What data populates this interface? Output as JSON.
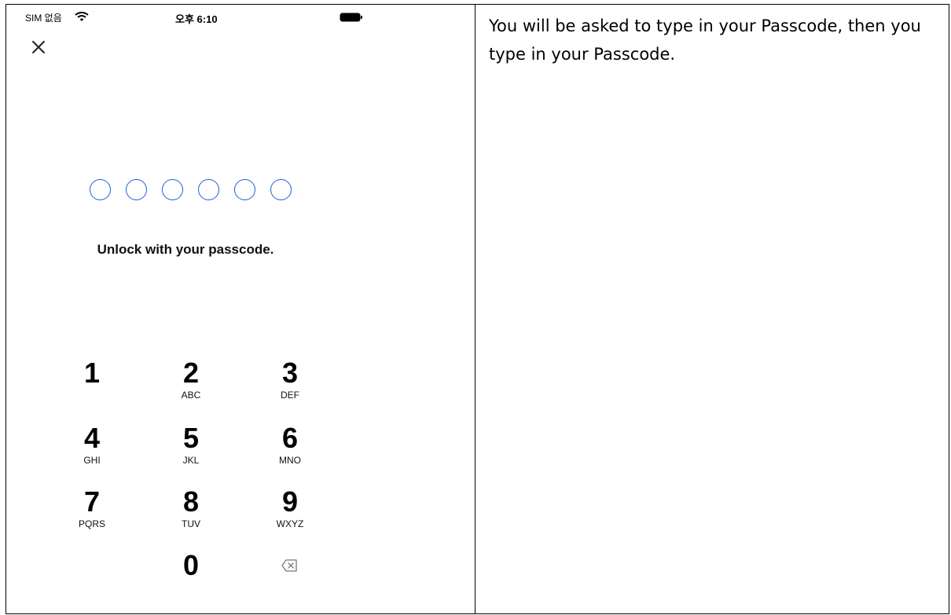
{
  "status_bar": {
    "carrier": "SIM 없음",
    "time": "오후 6:10"
  },
  "passcode": {
    "dot_count": 6,
    "dot_color": "#1f5fd6",
    "prompt": "Unlock with your passcode."
  },
  "keypad": {
    "keys": [
      {
        "digit": "1",
        "letters": ""
      },
      {
        "digit": "2",
        "letters": "ABC"
      },
      {
        "digit": "3",
        "letters": "DEF"
      },
      {
        "digit": "4",
        "letters": "GHI"
      },
      {
        "digit": "5",
        "letters": "JKL"
      },
      {
        "digit": "6",
        "letters": "MNO"
      },
      {
        "digit": "7",
        "letters": "PQRS"
      },
      {
        "digit": "8",
        "letters": "TUV"
      },
      {
        "digit": "9",
        "letters": "WXYZ"
      },
      {
        "digit": "0",
        "letters": ""
      }
    ],
    "backspace_icon": "backspace-icon"
  },
  "explanation": "You will be asked to type in your Passcode, then you type in your Passcode."
}
